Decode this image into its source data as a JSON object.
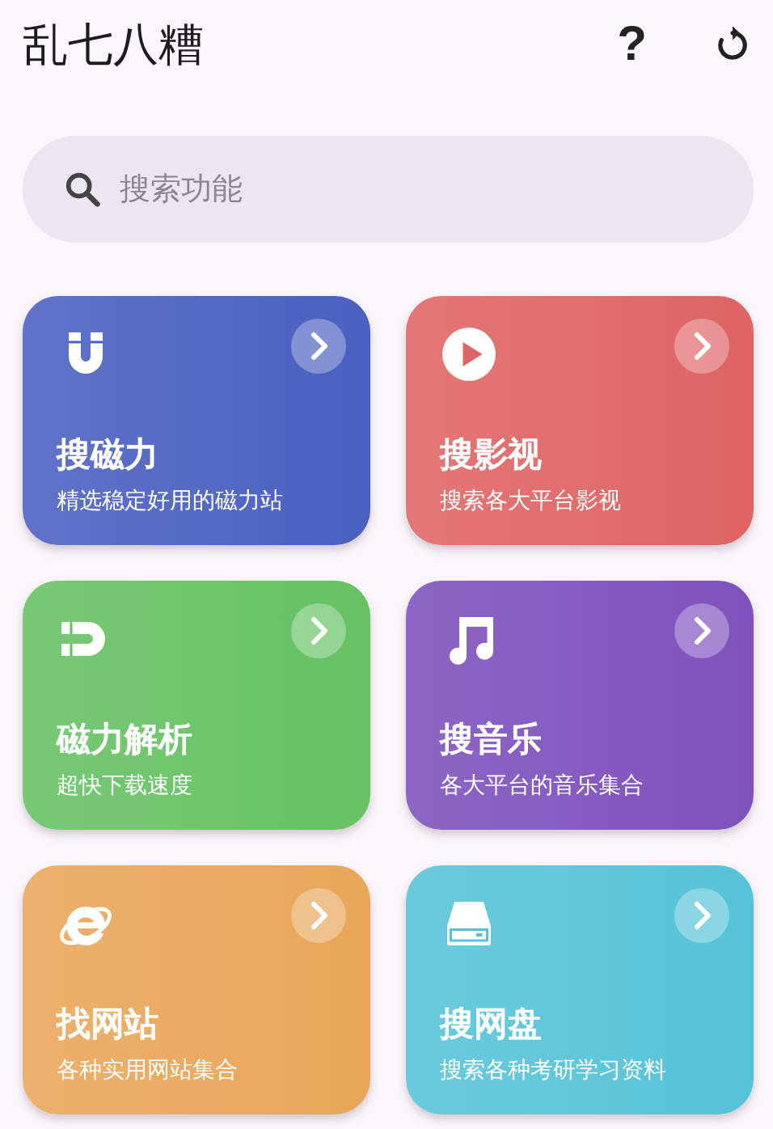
{
  "app_bar": {
    "title": "乱七八糟",
    "help": "?"
  },
  "search": {
    "placeholder": "搜索功能"
  },
  "cards": [
    {
      "kind": "magnet",
      "title": "搜磁力",
      "subtitle": "精选稳定好用的磁力站",
      "color": "#4a60c0"
    },
    {
      "kind": "play",
      "title": "搜影视",
      "subtitle": "搜索各大平台影视",
      "color": "#df6464"
    },
    {
      "kind": "horseshoe",
      "title": "磁力解析",
      "subtitle": "超快下载速度",
      "color": "#66c263"
    },
    {
      "kind": "music",
      "title": "搜音乐",
      "subtitle": "各大平台的音乐集合",
      "color": "#7e51bc"
    },
    {
      "kind": "browser",
      "title": "找网站",
      "subtitle": "各种实用网站集合",
      "color": "#e9a659"
    },
    {
      "kind": "drive",
      "title": "搜网盘",
      "subtitle": "搜索各种考研学习资料",
      "color": "#57c3d8"
    }
  ]
}
